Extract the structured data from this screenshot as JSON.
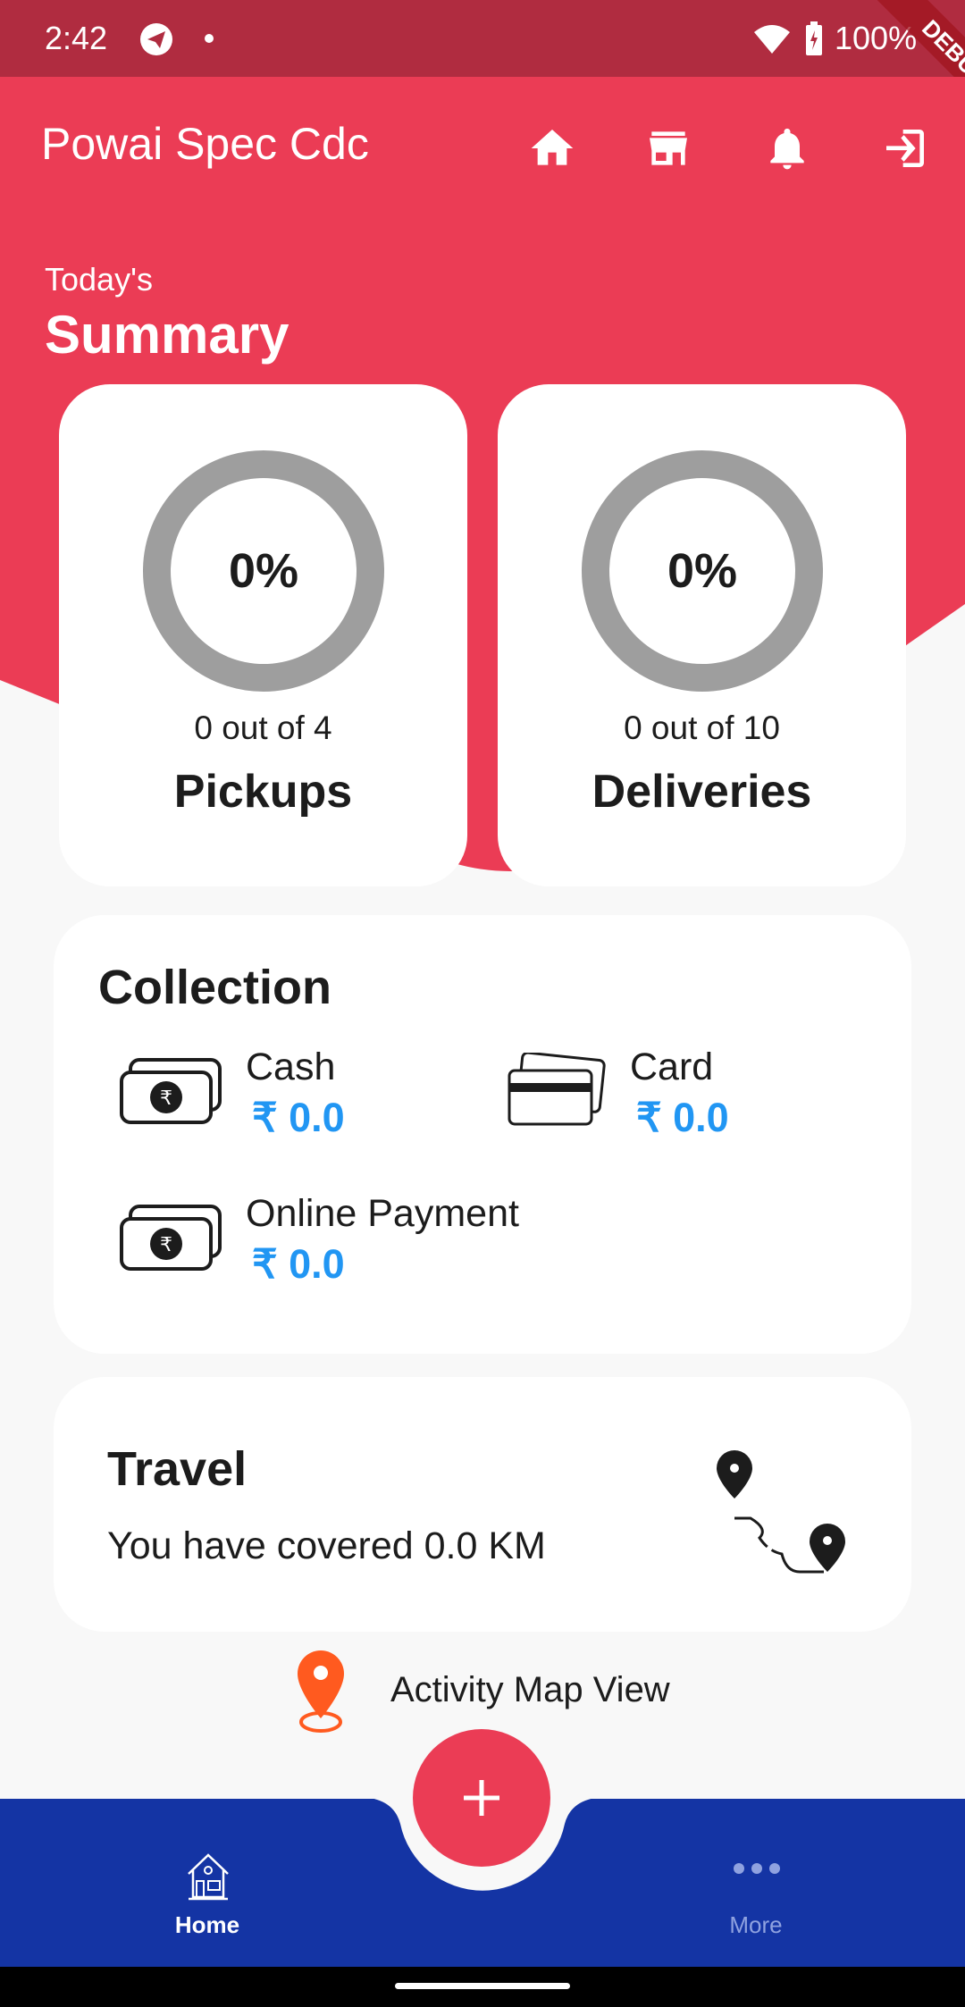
{
  "status_bar": {
    "time": "2:42",
    "battery": "100%",
    "debug_banner": "DEBUG"
  },
  "header": {
    "title": "Powai Spec Cdc",
    "icons": [
      "home-icon",
      "store-icon",
      "bell-icon",
      "logout-icon"
    ]
  },
  "summary": {
    "subtitle": "Today's",
    "title": "Summary"
  },
  "pickups": {
    "percent": "0%",
    "count_text": "0 out of 4",
    "label": "Pickups",
    "progress": 0
  },
  "deliveries": {
    "percent": "0%",
    "count_text": "0 out of 10",
    "label": "Deliveries",
    "progress": 0
  },
  "collection": {
    "title": "Collection",
    "items": [
      {
        "label": "Cash",
        "value": "₹ 0.0"
      },
      {
        "label": "Card",
        "value": "₹ 0.0"
      },
      {
        "label": "Online Payment",
        "value": "₹ 0.0"
      }
    ]
  },
  "travel": {
    "title": "Travel",
    "text": "You have covered 0.0 KM"
  },
  "activity_map": {
    "label": "Activity Map View"
  },
  "bottom_nav": {
    "home": "Home",
    "more": "More"
  },
  "colors": {
    "primary": "#eb3c55",
    "status_bar": "#b02c40",
    "nav": "#1434a4",
    "amount": "#2196f3",
    "ring": "#9e9e9e",
    "pin": "#ff5a1f"
  }
}
